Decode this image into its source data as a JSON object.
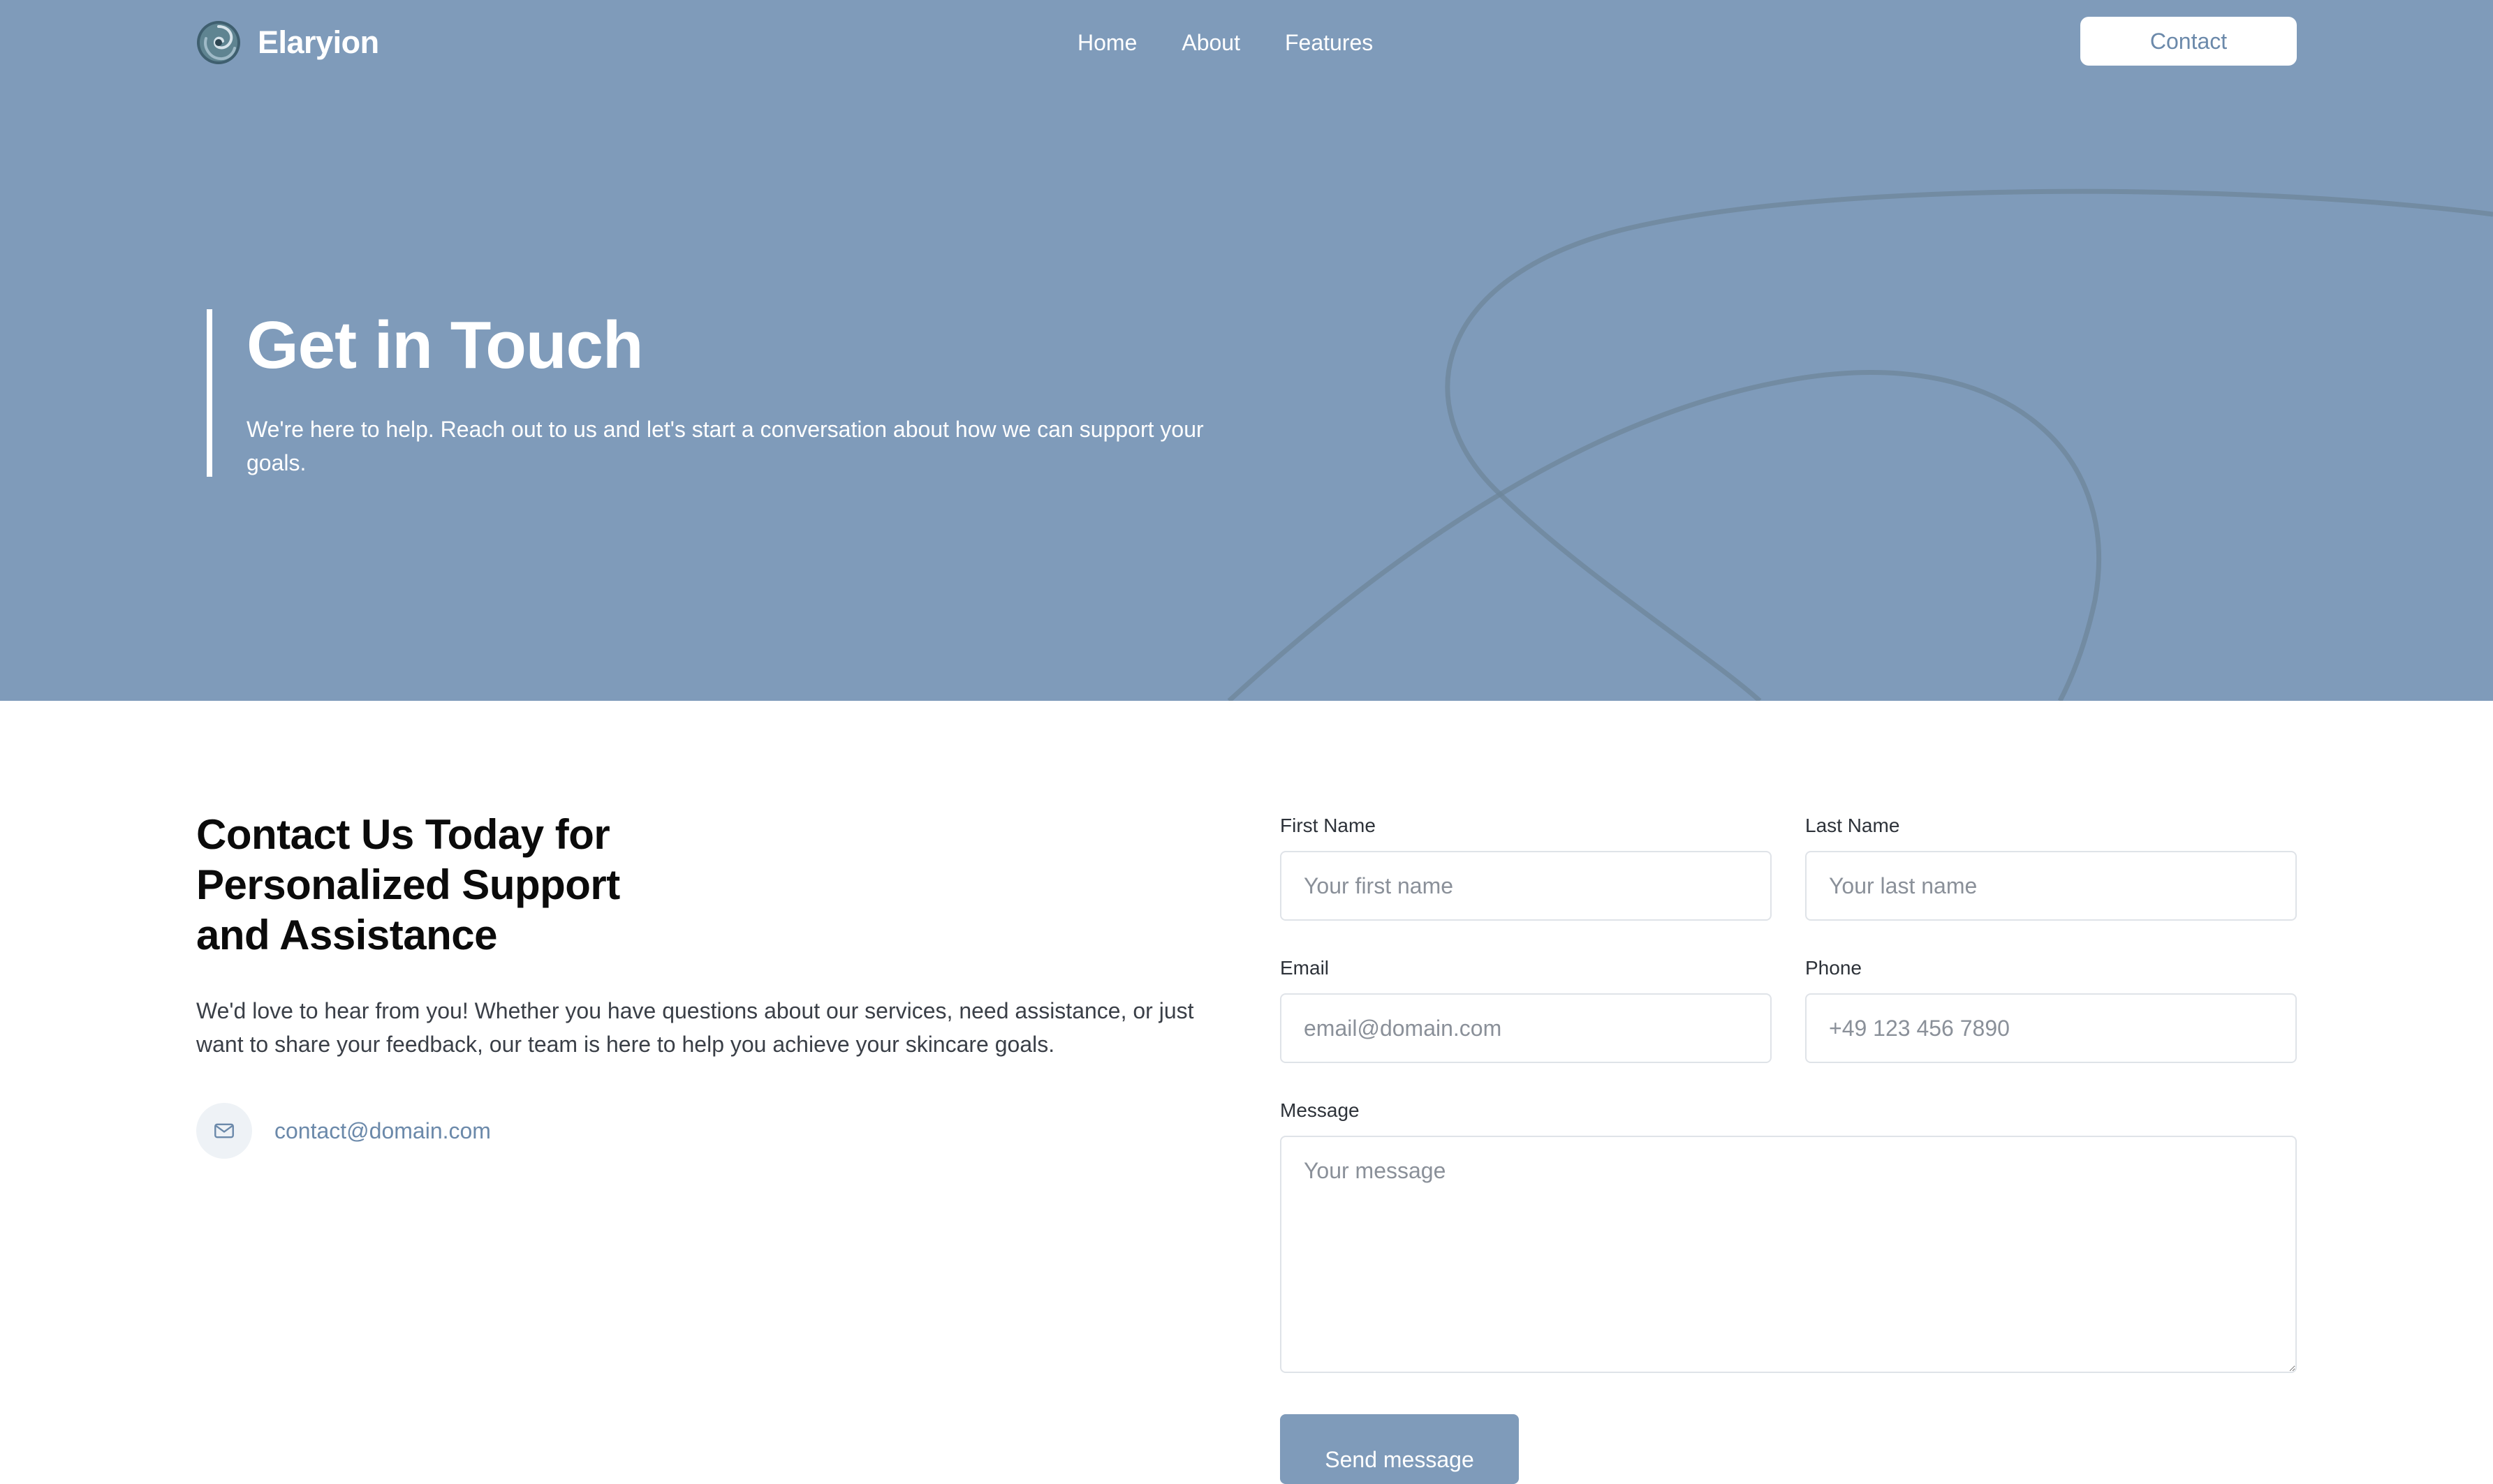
{
  "brand": {
    "name": "Elaryion",
    "logo_icon": "swirl-logo-icon"
  },
  "nav": {
    "links": [
      "Home",
      "About",
      "Features"
    ],
    "cta": "Contact"
  },
  "hero": {
    "title": "Get in Touch",
    "subtitle": "We're here to help. Reach out to us and let's start a conversation about how we can support your goals."
  },
  "contact_info": {
    "title": "Contact Us Today for Personalized Support and Assistance",
    "text": "We'd love to hear from you! Whether you have questions about our services, need assistance, or just want to share your feedback, our team is here to help you achieve your skincare goals.",
    "email": "contact@domain.com",
    "email_icon": "mail-icon"
  },
  "form": {
    "first_name": {
      "label": "First Name",
      "placeholder": "Your first name"
    },
    "last_name": {
      "label": "Last Name",
      "placeholder": "Your last name"
    },
    "email": {
      "label": "Email",
      "placeholder": "email@domain.com"
    },
    "phone": {
      "label": "Phone",
      "placeholder": "+49 123 456 7890"
    },
    "message": {
      "label": "Message",
      "placeholder": "Your message"
    },
    "submit": "Send message"
  },
  "colors": {
    "hero_background": "#7f9bba",
    "accent": "#6b89aa",
    "white": "#ffffff"
  }
}
